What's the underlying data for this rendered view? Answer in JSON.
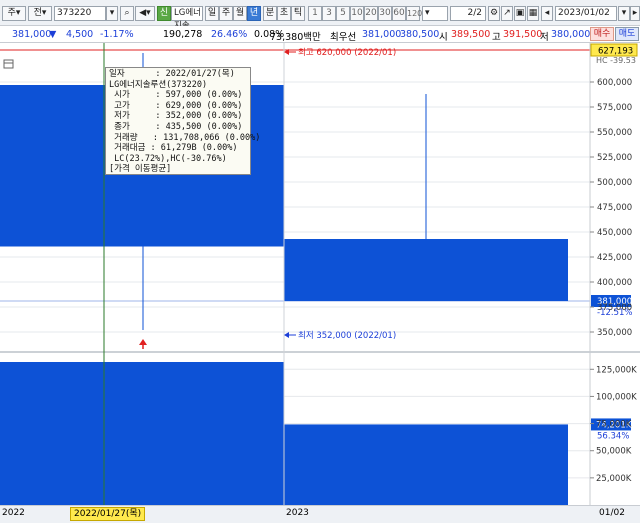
{
  "toolbar": {
    "market_code": "주",
    "type": "전",
    "stock_code": "373220",
    "stock_badge": "신",
    "stock_name": "LG에너지솔",
    "period_day": "일",
    "period_week": "주",
    "period_month": "월",
    "period_year": "년",
    "period_minute": "분",
    "period_second": "초",
    "period_tick": "틱",
    "intervals": [
      "1",
      "3",
      "5",
      "10",
      "20",
      "30",
      "60",
      "120"
    ],
    "page": "2/2",
    "date": "2023/01/02"
  },
  "quote": {
    "price": "381,000",
    "change_arrow": "▼",
    "change": "4,500",
    "change_pct": "-1.17%",
    "volume": "190,278",
    "volume_ratio": "26.46%",
    "turnover": "0.08%",
    "amount": "73,380백만",
    "best_label": "최우선",
    "best_ask": "381,000",
    "best_bid": "380,500",
    "open_label": "시",
    "open": "389,500",
    "high_label": "고",
    "high": "391,500",
    "low_label": "저",
    "low": "380,000",
    "buy_label": "매수",
    "sell_label": "매도"
  },
  "chart_data": {
    "type": "candlestick",
    "price_axis_ticks": [
      "600,000",
      "575,000",
      "550,000",
      "525,000",
      "500,000",
      "475,000",
      "450,000",
      "425,000",
      "400,000",
      "375,000",
      "350,000"
    ],
    "volume_axis_ticks": [
      "125,000K",
      "100,000K",
      "75,000K",
      "50,000K",
      "25,000K"
    ],
    "x_labels": [
      "2022",
      "2023",
      "01/02"
    ],
    "price_ylim": [
      330000,
      632000
    ],
    "volume_ylim": [
      0,
      140000
    ],
    "candles": [
      {
        "period": "2022",
        "open": 597000,
        "high": 629000,
        "low": 352000,
        "close": 435500,
        "volume": 131708
      },
      {
        "period": "2023",
        "open": 443000,
        "high": 588000,
        "low": 381000,
        "close": 381000,
        "volume": 74201
      }
    ],
    "high_marker": "최고 620,000 (2022/01)",
    "low_marker": "최저 352,000 (2022/01)",
    "current_price_tag": "381,000",
    "current_pct": "-12.51%",
    "top_price_tag": "627,193",
    "top_pct_partial": "HC -39.53",
    "volume_tag": "74,201K",
    "volume_pct": "56.34%",
    "cursor_date": "2022/01/27(목)"
  },
  "tooltip": {
    "lines": [
      "일자      : 2022/01/27(목)",
      "LG에너지솔루션(373220)",
      " 시가     : 597,000 (0.00%)",
      " 고가     : 629,000 (0.00%)",
      " 저가     : 352,000 (0.00%)",
      " 종가     : 435,500 (0.00%)",
      " 거래량   : 131,708,066 (0.00%)",
      " 거래대금 : 61,279B (0.00%)",
      " LC(23.72%),HC(-30.76%)",
      "[가격 이동평균]"
    ]
  },
  "colors": {
    "candle_down": "#0d52d6",
    "rise_marker": "#e02020",
    "fall_marker": "#1c3fd8",
    "cursor_line": "#2a7a2a",
    "current_price_line": "#1c3fd8"
  }
}
